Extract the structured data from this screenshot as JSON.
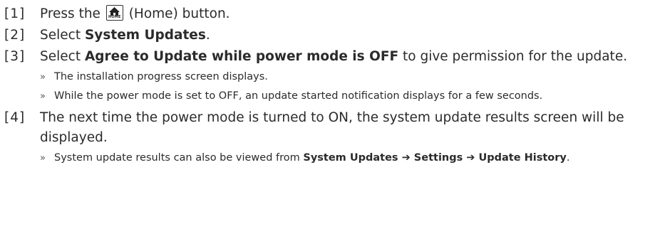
{
  "steps": [
    {
      "num": "[1]",
      "pre": "Press the",
      "icon": "home-icon",
      "icon_text": "HOME",
      "post": "(Home) button."
    },
    {
      "num": "[2]",
      "pre": "Select",
      "bold": "System Updates",
      "post": "."
    },
    {
      "num": "[3]",
      "pre": "Select",
      "bold": "Agree to Update while power mode is OFF",
      "post": "to give permission for the update.",
      "results": [
        {
          "text": "The installation progress screen displays."
        },
        {
          "text": "While the power mode is set to OFF, an update started notification displays for a few seconds."
        }
      ]
    },
    {
      "num": "[4]",
      "text": "The next time the power mode is turned to ON, the system update results screen will be displayed.",
      "results": [
        {
          "pre": "System update results can also be viewed from",
          "bold": "System Updates ➔ Settings ➔ Update History",
          "post": "."
        }
      ]
    }
  ],
  "result_marker": "»"
}
